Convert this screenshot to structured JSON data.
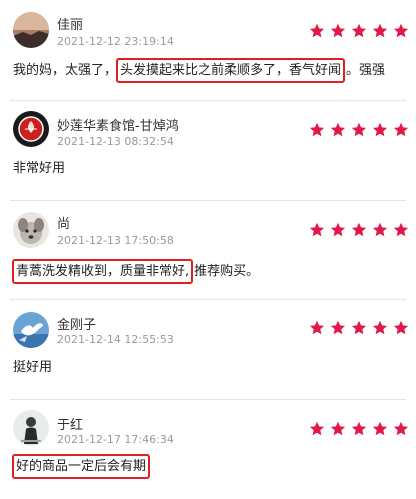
{
  "reviews": [
    {
      "name": "佳丽",
      "time": "2021-12-12 23:19:14",
      "rating": 5,
      "avatar": "sunset-avatar",
      "content_pre": "我的妈，太强了，",
      "content_highlight": "头发摸起来比之前柔顺多了，香气好闻",
      "content_post": "。强强"
    },
    {
      "name": "妙莲华素食馆-甘焯鸿",
      "time": "2021-12-13 08:32:54",
      "rating": 5,
      "avatar": "red-lotus-avatar",
      "content_pre": "非常好用",
      "content_highlight": "",
      "content_post": ""
    },
    {
      "name": "尚",
      "time": "2021-12-13 17:50:58",
      "rating": 5,
      "avatar": "dog-avatar",
      "content_pre": "",
      "content_highlight": "青蒿洗发精收到，质量非常好,",
      "content_post": "推荐购买。"
    },
    {
      "name": "金刚子",
      "time": "2021-12-14 12:55:53",
      "rating": 5,
      "avatar": "dove-avatar",
      "content_pre": "挺好用",
      "content_highlight": "",
      "content_post": ""
    },
    {
      "name": "于红",
      "time": "2021-12-17 17:46:34",
      "rating": 5,
      "avatar": "person-avatar",
      "content_pre": "",
      "content_highlight": "好的商品一定后会有期",
      "content_post": ""
    }
  ],
  "colors": {
    "star": "#e0194a",
    "highlight_border": "#e02020",
    "time_text": "#9a9a9a"
  }
}
